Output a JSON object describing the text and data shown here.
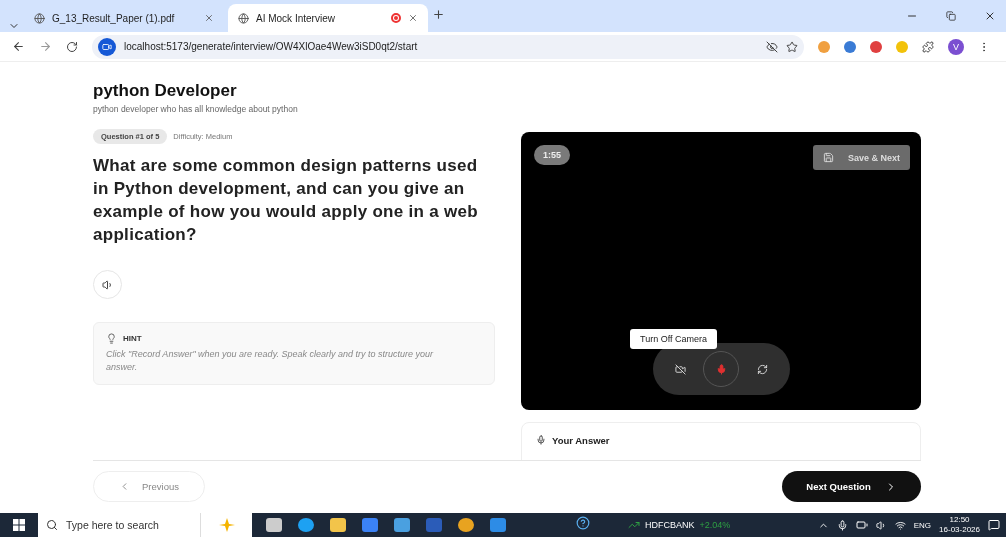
{
  "browser": {
    "tabs": [
      {
        "title": "G_13_Result_Paper (1).pdf",
        "selected": false,
        "recording": false
      },
      {
        "title": "AI Mock Interview",
        "selected": true,
        "recording": true
      }
    ],
    "url": "localhost:5173/generate/interview/OW4XlOae4Wew3iSD0qt2/start",
    "profile": "V"
  },
  "interview": {
    "title": "python Developer",
    "subtitle": "python developer who has all knowledge about python",
    "badge": "Question #1 of 5",
    "difficulty": "Difficulty: Medium",
    "question": "What are some common design patterns used in Python development, and can you give an example of how you would apply one in a web application?",
    "hint": {
      "label": "HINT",
      "text": "Click \"Record Answer\" when you are ready. Speak clearly and try to structure your answer."
    },
    "video": {
      "timer": "1:55",
      "save_button": "Save & Next",
      "tooltip": "Turn Off Camera",
      "recording": true
    },
    "answer_label": "Your Answer",
    "previous": "Previous",
    "next": "Next Question"
  },
  "taskbar": {
    "search_placeholder": "Type here to search",
    "stock": "HDFCBANK",
    "change": "+2.04%",
    "language": "ENG",
    "time": "12:50",
    "date": "16-03-2026"
  }
}
